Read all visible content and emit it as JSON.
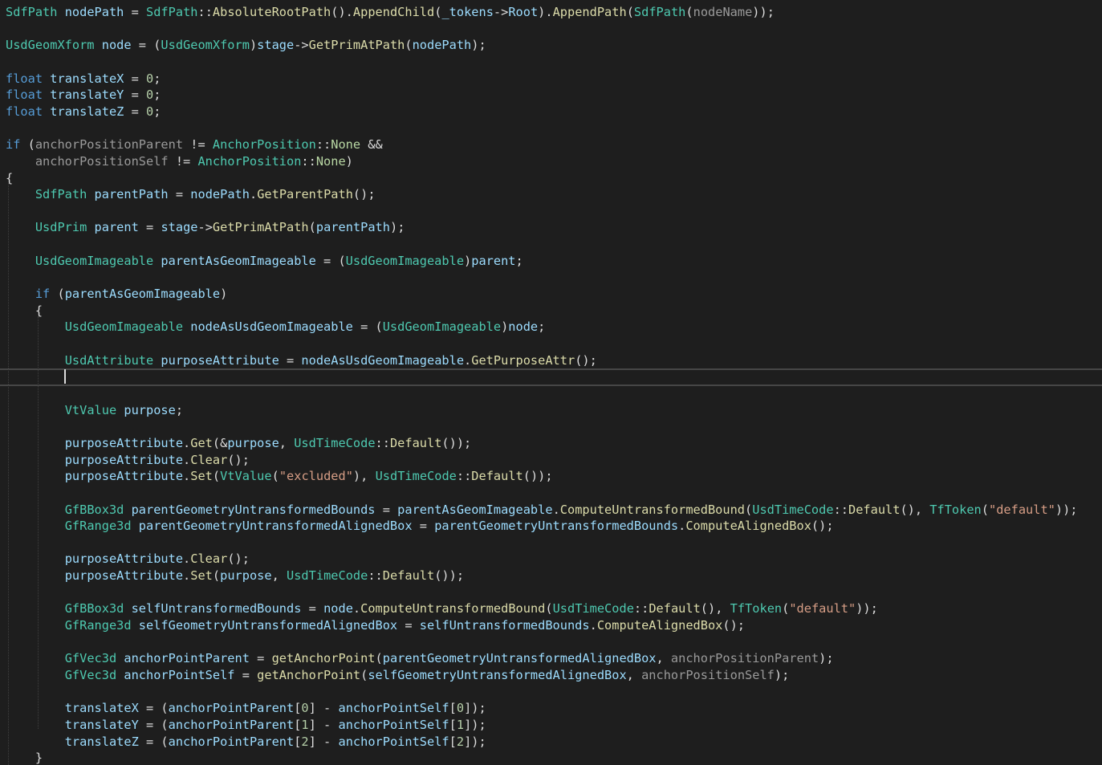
{
  "editor": {
    "colors": {
      "background": "#1e1e1e",
      "type": "#4ec9b0",
      "keyword": "#569cd6",
      "local": "#9cdcfe",
      "param": "#9a9a9a",
      "method": "#dcdcaa",
      "string": "#d69d85",
      "number": "#b5cea8",
      "punct": "#dcdcdc",
      "enum": "#b8d7a3"
    },
    "cursor_line": 23,
    "lines": [
      [
        [
          "type",
          "SdfPath"
        ],
        [
          "p",
          " "
        ],
        [
          "local",
          "nodePath"
        ],
        [
          "p",
          " = "
        ],
        [
          "type",
          "SdfPath"
        ],
        [
          "p",
          "::"
        ],
        [
          "method",
          "AbsoluteRootPath"
        ],
        [
          "p",
          "()."
        ],
        [
          "method",
          "AppendChild"
        ],
        [
          "p",
          "("
        ],
        [
          "local",
          "_tokens"
        ],
        [
          "p",
          "->"
        ],
        [
          "local",
          "Root"
        ],
        [
          "p",
          ")."
        ],
        [
          "method",
          "AppendPath"
        ],
        [
          "p",
          "("
        ],
        [
          "type",
          "SdfPath"
        ],
        [
          "p",
          "("
        ],
        [
          "param",
          "nodeName"
        ],
        [
          "p",
          "));"
        ]
      ],
      [],
      [
        [
          "type",
          "UsdGeomXform"
        ],
        [
          "p",
          " "
        ],
        [
          "local",
          "node"
        ],
        [
          "p",
          " = ("
        ],
        [
          "type",
          "UsdGeomXform"
        ],
        [
          "p",
          ")"
        ],
        [
          "local",
          "stage"
        ],
        [
          "p",
          "->"
        ],
        [
          "method",
          "GetPrimAtPath"
        ],
        [
          "p",
          "("
        ],
        [
          "local",
          "nodePath"
        ],
        [
          "p",
          ");"
        ]
      ],
      [],
      [
        [
          "keyword",
          "float"
        ],
        [
          "p",
          " "
        ],
        [
          "local",
          "translateX"
        ],
        [
          "p",
          " = "
        ],
        [
          "number",
          "0"
        ],
        [
          "p",
          ";"
        ]
      ],
      [
        [
          "keyword",
          "float"
        ],
        [
          "p",
          " "
        ],
        [
          "local",
          "translateY"
        ],
        [
          "p",
          " = "
        ],
        [
          "number",
          "0"
        ],
        [
          "p",
          ";"
        ]
      ],
      [
        [
          "keyword",
          "float"
        ],
        [
          "p",
          " "
        ],
        [
          "local",
          "translateZ"
        ],
        [
          "p",
          " = "
        ],
        [
          "number",
          "0"
        ],
        [
          "p",
          ";"
        ]
      ],
      [],
      [
        [
          "keyword",
          "if"
        ],
        [
          "p",
          " ("
        ],
        [
          "param",
          "anchorPositionParent"
        ],
        [
          "p",
          " != "
        ],
        [
          "type",
          "AnchorPosition"
        ],
        [
          "p",
          "::"
        ],
        [
          "enum",
          "None"
        ],
        [
          "p",
          " &&"
        ]
      ],
      [
        [
          "p",
          "    "
        ],
        [
          "param",
          "anchorPositionSelf"
        ],
        [
          "p",
          " != "
        ],
        [
          "type",
          "AnchorPosition"
        ],
        [
          "p",
          "::"
        ],
        [
          "enum",
          "None"
        ],
        [
          "p",
          ")"
        ]
      ],
      [
        [
          "p",
          "{"
        ]
      ],
      [
        [
          "p",
          "    "
        ],
        [
          "type",
          "SdfPath"
        ],
        [
          "p",
          " "
        ],
        [
          "local",
          "parentPath"
        ],
        [
          "p",
          " = "
        ],
        [
          "local",
          "nodePath"
        ],
        [
          "p",
          "."
        ],
        [
          "method",
          "GetParentPath"
        ],
        [
          "p",
          "();"
        ]
      ],
      [],
      [
        [
          "p",
          "    "
        ],
        [
          "type",
          "UsdPrim"
        ],
        [
          "p",
          " "
        ],
        [
          "local",
          "parent"
        ],
        [
          "p",
          " = "
        ],
        [
          "local",
          "stage"
        ],
        [
          "p",
          "->"
        ],
        [
          "method",
          "GetPrimAtPath"
        ],
        [
          "p",
          "("
        ],
        [
          "local",
          "parentPath"
        ],
        [
          "p",
          ");"
        ]
      ],
      [],
      [
        [
          "p",
          "    "
        ],
        [
          "type",
          "UsdGeomImageable"
        ],
        [
          "p",
          " "
        ],
        [
          "local",
          "parentAsGeomImageable"
        ],
        [
          "p",
          " = ("
        ],
        [
          "type",
          "UsdGeomImageable"
        ],
        [
          "p",
          ")"
        ],
        [
          "local",
          "parent"
        ],
        [
          "p",
          ";"
        ]
      ],
      [],
      [
        [
          "p",
          "    "
        ],
        [
          "keyword",
          "if"
        ],
        [
          "p",
          " ("
        ],
        [
          "local",
          "parentAsGeomImageable"
        ],
        [
          "p",
          ")"
        ]
      ],
      [
        [
          "p",
          "    {"
        ]
      ],
      [
        [
          "p",
          "        "
        ],
        [
          "type",
          "UsdGeomImageable"
        ],
        [
          "p",
          " "
        ],
        [
          "local",
          "nodeAsUsdGeomImageable"
        ],
        [
          "p",
          " = ("
        ],
        [
          "type",
          "UsdGeomImageable"
        ],
        [
          "p",
          ")"
        ],
        [
          "local",
          "node"
        ],
        [
          "p",
          ";"
        ]
      ],
      [],
      [
        [
          "p",
          "        "
        ],
        [
          "type",
          "UsdAttribute"
        ],
        [
          "p",
          " "
        ],
        [
          "local",
          "purposeAttribute"
        ],
        [
          "p",
          " = "
        ],
        [
          "local",
          "nodeAsUsdGeomImageable"
        ],
        [
          "p",
          "."
        ],
        [
          "method",
          "GetPurposeAttr"
        ],
        [
          "p",
          "();"
        ]
      ],
      [],
      [],
      [
        [
          "p",
          "        "
        ],
        [
          "type",
          "VtValue"
        ],
        [
          "p",
          " "
        ],
        [
          "local",
          "purpose"
        ],
        [
          "p",
          ";"
        ]
      ],
      [],
      [
        [
          "p",
          "        "
        ],
        [
          "local",
          "purposeAttribute"
        ],
        [
          "p",
          "."
        ],
        [
          "method",
          "Get"
        ],
        [
          "p",
          "(&"
        ],
        [
          "local",
          "purpose"
        ],
        [
          "p",
          ", "
        ],
        [
          "type",
          "UsdTimeCode"
        ],
        [
          "p",
          "::"
        ],
        [
          "method",
          "Default"
        ],
        [
          "p",
          "());"
        ]
      ],
      [
        [
          "p",
          "        "
        ],
        [
          "local",
          "purposeAttribute"
        ],
        [
          "p",
          "."
        ],
        [
          "method",
          "Clear"
        ],
        [
          "p",
          "();"
        ]
      ],
      [
        [
          "p",
          "        "
        ],
        [
          "local",
          "purposeAttribute"
        ],
        [
          "p",
          "."
        ],
        [
          "method",
          "Set"
        ],
        [
          "p",
          "("
        ],
        [
          "type",
          "VtValue"
        ],
        [
          "p",
          "("
        ],
        [
          "string",
          "\"excluded\""
        ],
        [
          "p",
          "), "
        ],
        [
          "type",
          "UsdTimeCode"
        ],
        [
          "p",
          "::"
        ],
        [
          "method",
          "Default"
        ],
        [
          "p",
          "());"
        ]
      ],
      [],
      [
        [
          "p",
          "        "
        ],
        [
          "type",
          "GfBBox3d"
        ],
        [
          "p",
          " "
        ],
        [
          "local",
          "parentGeometryUntransformedBounds"
        ],
        [
          "p",
          " = "
        ],
        [
          "local",
          "parentAsGeomImageable"
        ],
        [
          "p",
          "."
        ],
        [
          "method",
          "ComputeUntransformedBound"
        ],
        [
          "p",
          "("
        ],
        [
          "type",
          "UsdTimeCode"
        ],
        [
          "p",
          "::"
        ],
        [
          "method",
          "Default"
        ],
        [
          "p",
          "(), "
        ],
        [
          "type",
          "TfToken"
        ],
        [
          "p",
          "("
        ],
        [
          "string",
          "\"default\""
        ],
        [
          "p",
          "));"
        ]
      ],
      [
        [
          "p",
          "        "
        ],
        [
          "type",
          "GfRange3d"
        ],
        [
          "p",
          " "
        ],
        [
          "local",
          "parentGeometryUntransformedAlignedBox"
        ],
        [
          "p",
          " = "
        ],
        [
          "local",
          "parentGeometryUntransformedBounds"
        ],
        [
          "p",
          "."
        ],
        [
          "method",
          "ComputeAlignedBox"
        ],
        [
          "p",
          "();"
        ]
      ],
      [],
      [
        [
          "p",
          "        "
        ],
        [
          "local",
          "purposeAttribute"
        ],
        [
          "p",
          "."
        ],
        [
          "method",
          "Clear"
        ],
        [
          "p",
          "();"
        ]
      ],
      [
        [
          "p",
          "        "
        ],
        [
          "local",
          "purposeAttribute"
        ],
        [
          "p",
          "."
        ],
        [
          "method",
          "Set"
        ],
        [
          "p",
          "("
        ],
        [
          "local",
          "purpose"
        ],
        [
          "p",
          ", "
        ],
        [
          "type",
          "UsdTimeCode"
        ],
        [
          "p",
          "::"
        ],
        [
          "method",
          "Default"
        ],
        [
          "p",
          "());"
        ]
      ],
      [],
      [
        [
          "p",
          "        "
        ],
        [
          "type",
          "GfBBox3d"
        ],
        [
          "p",
          " "
        ],
        [
          "local",
          "selfUntransformedBounds"
        ],
        [
          "p",
          " = "
        ],
        [
          "local",
          "node"
        ],
        [
          "p",
          "."
        ],
        [
          "method",
          "ComputeUntransformedBound"
        ],
        [
          "p",
          "("
        ],
        [
          "type",
          "UsdTimeCode"
        ],
        [
          "p",
          "::"
        ],
        [
          "method",
          "Default"
        ],
        [
          "p",
          "(), "
        ],
        [
          "type",
          "TfToken"
        ],
        [
          "p",
          "("
        ],
        [
          "string",
          "\"default\""
        ],
        [
          "p",
          "));"
        ]
      ],
      [
        [
          "p",
          "        "
        ],
        [
          "type",
          "GfRange3d"
        ],
        [
          "p",
          " "
        ],
        [
          "local",
          "selfGeometryUntransformedAlignedBox"
        ],
        [
          "p",
          " = "
        ],
        [
          "local",
          "selfUntransformedBounds"
        ],
        [
          "p",
          "."
        ],
        [
          "method",
          "ComputeAlignedBox"
        ],
        [
          "p",
          "();"
        ]
      ],
      [],
      [
        [
          "p",
          "        "
        ],
        [
          "type",
          "GfVec3d"
        ],
        [
          "p",
          " "
        ],
        [
          "local",
          "anchorPointParent"
        ],
        [
          "p",
          " = "
        ],
        [
          "method",
          "getAnchorPoint"
        ],
        [
          "p",
          "("
        ],
        [
          "local",
          "parentGeometryUntransformedAlignedBox"
        ],
        [
          "p",
          ", "
        ],
        [
          "param",
          "anchorPositionParent"
        ],
        [
          "p",
          ");"
        ]
      ],
      [
        [
          "p",
          "        "
        ],
        [
          "type",
          "GfVec3d"
        ],
        [
          "p",
          " "
        ],
        [
          "local",
          "anchorPointSelf"
        ],
        [
          "p",
          " = "
        ],
        [
          "method",
          "getAnchorPoint"
        ],
        [
          "p",
          "("
        ],
        [
          "local",
          "selfGeometryUntransformedAlignedBox"
        ],
        [
          "p",
          ", "
        ],
        [
          "param",
          "anchorPositionSelf"
        ],
        [
          "p",
          ");"
        ]
      ],
      [],
      [
        [
          "p",
          "        "
        ],
        [
          "local",
          "translateX"
        ],
        [
          "p",
          " = ("
        ],
        [
          "local",
          "anchorPointParent"
        ],
        [
          "p",
          "["
        ],
        [
          "number",
          "0"
        ],
        [
          "p",
          "] - "
        ],
        [
          "local",
          "anchorPointSelf"
        ],
        [
          "p",
          "["
        ],
        [
          "number",
          "0"
        ],
        [
          "p",
          "]);"
        ]
      ],
      [
        [
          "p",
          "        "
        ],
        [
          "local",
          "translateY"
        ],
        [
          "p",
          " = ("
        ],
        [
          "local",
          "anchorPointParent"
        ],
        [
          "p",
          "["
        ],
        [
          "number",
          "1"
        ],
        [
          "p",
          "] - "
        ],
        [
          "local",
          "anchorPointSelf"
        ],
        [
          "p",
          "["
        ],
        [
          "number",
          "1"
        ],
        [
          "p",
          "]);"
        ]
      ],
      [
        [
          "p",
          "        "
        ],
        [
          "local",
          "translateZ"
        ],
        [
          "p",
          " = ("
        ],
        [
          "local",
          "anchorPointParent"
        ],
        [
          "p",
          "["
        ],
        [
          "number",
          "2"
        ],
        [
          "p",
          "] - "
        ],
        [
          "local",
          "anchorPointSelf"
        ],
        [
          "p",
          "["
        ],
        [
          "number",
          "2"
        ],
        [
          "p",
          "]);"
        ]
      ],
      [
        [
          "p",
          "    }"
        ]
      ]
    ]
  }
}
